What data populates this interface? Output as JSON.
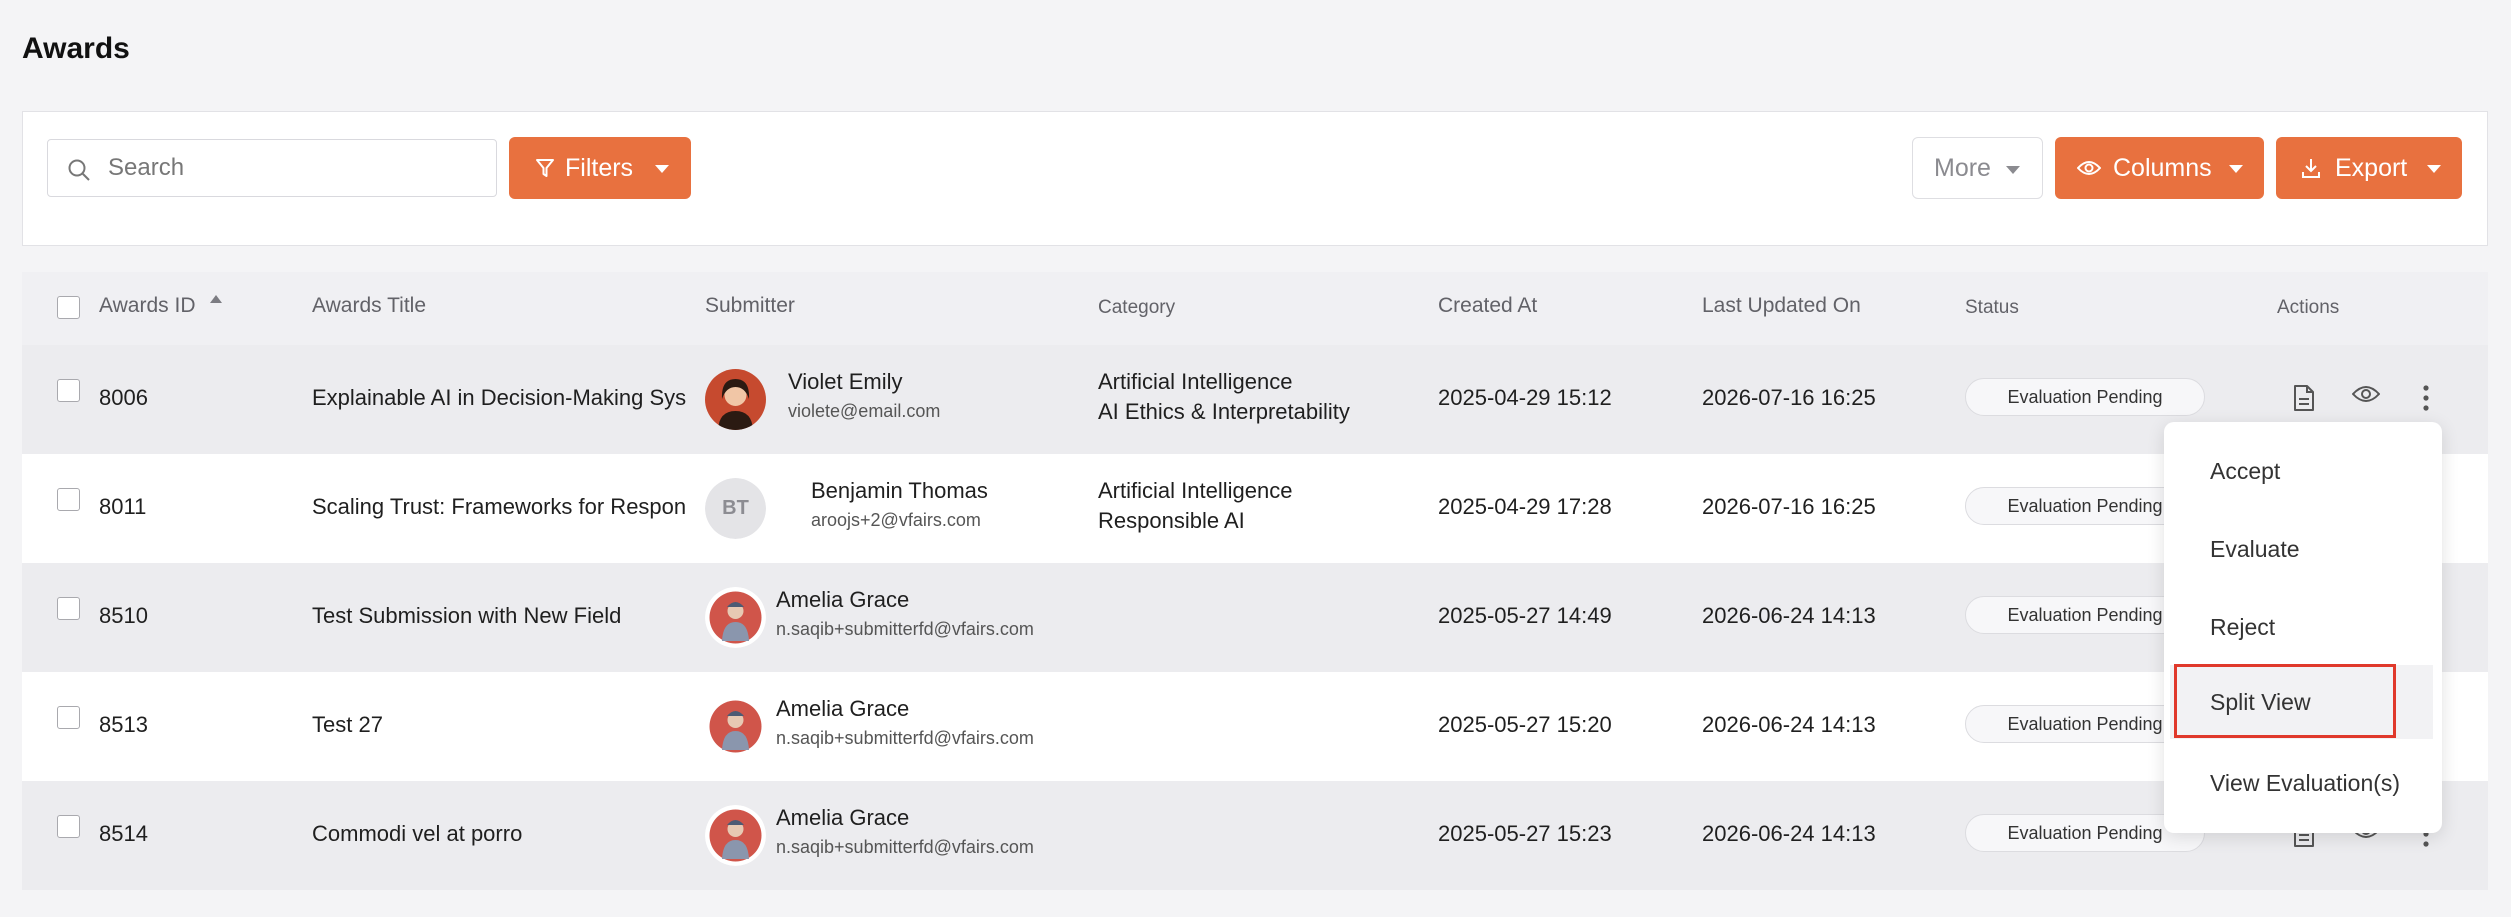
{
  "page": {
    "title": "Awards"
  },
  "toolbar": {
    "search_placeholder": "Search",
    "filters_label": "Filters",
    "more_label": "More",
    "columns_label": "Columns",
    "export_label": "Export",
    "accent_color": "#e8713f"
  },
  "table": {
    "headers": {
      "id": "Awards ID",
      "title": "Awards Title",
      "submitter": "Submitter",
      "category": "Category",
      "created": "Created At",
      "updated": "Last Updated On",
      "status": "Status",
      "actions": "Actions"
    },
    "rows": [
      {
        "id": "8006",
        "title": "Explainable AI in Decision-Making Sys",
        "name": "Violet Emily",
        "email": "violete@email.com",
        "category1": "Artificial Intelligence",
        "category2": "AI Ethics & Interpretability",
        "created": "2025-04-29 15:12",
        "updated": "2026-07-16 16:25",
        "status": "Evaluation Pending",
        "avatar": "photo-woman"
      },
      {
        "id": "8011",
        "title": "Scaling Trust: Frameworks for Respon",
        "name": "Benjamin Thomas",
        "email": "aroojs+2@vfairs.com",
        "category1": "Artificial Intelligence",
        "category2": "Responsible AI",
        "created": "2025-04-29 17:28",
        "updated": "2026-07-16 16:25",
        "status": "Evaluation Pending",
        "avatar_initials": "BT"
      },
      {
        "id": "8510",
        "title": "Test Submission with New Field",
        "name": "Amelia Grace",
        "email": "n.saqib+submitterfd@vfairs.com",
        "category1": "",
        "category2": "",
        "created": "2025-05-27 14:49",
        "updated": "2026-06-24 14:13",
        "status": "Evaluation Pending",
        "avatar": "photo-cartoon"
      },
      {
        "id": "8513",
        "title": "Test 27",
        "name": "Amelia Grace",
        "email": "n.saqib+submitterfd@vfairs.com",
        "category1": "",
        "category2": "",
        "created": "2025-05-27 15:20",
        "updated": "2026-06-24 14:13",
        "status": "Evaluation Pending",
        "avatar": "photo-cartoon"
      },
      {
        "id": "8514",
        "title": "Commodi vel at porro",
        "name": "Amelia Grace",
        "email": "n.saqib+submitterfd@vfairs.com",
        "category1": "",
        "category2": "",
        "created": "2025-05-27 15:23",
        "updated": "2026-06-24 14:13",
        "status": "Evaluation Pending",
        "avatar": "photo-cartoon"
      }
    ]
  },
  "action_menu": {
    "items": [
      "Accept",
      "Evaluate",
      "Reject",
      "Split View",
      "View Evaluation(s)"
    ],
    "highlighted": "Split View",
    "highlight_color": "#e0392b"
  }
}
